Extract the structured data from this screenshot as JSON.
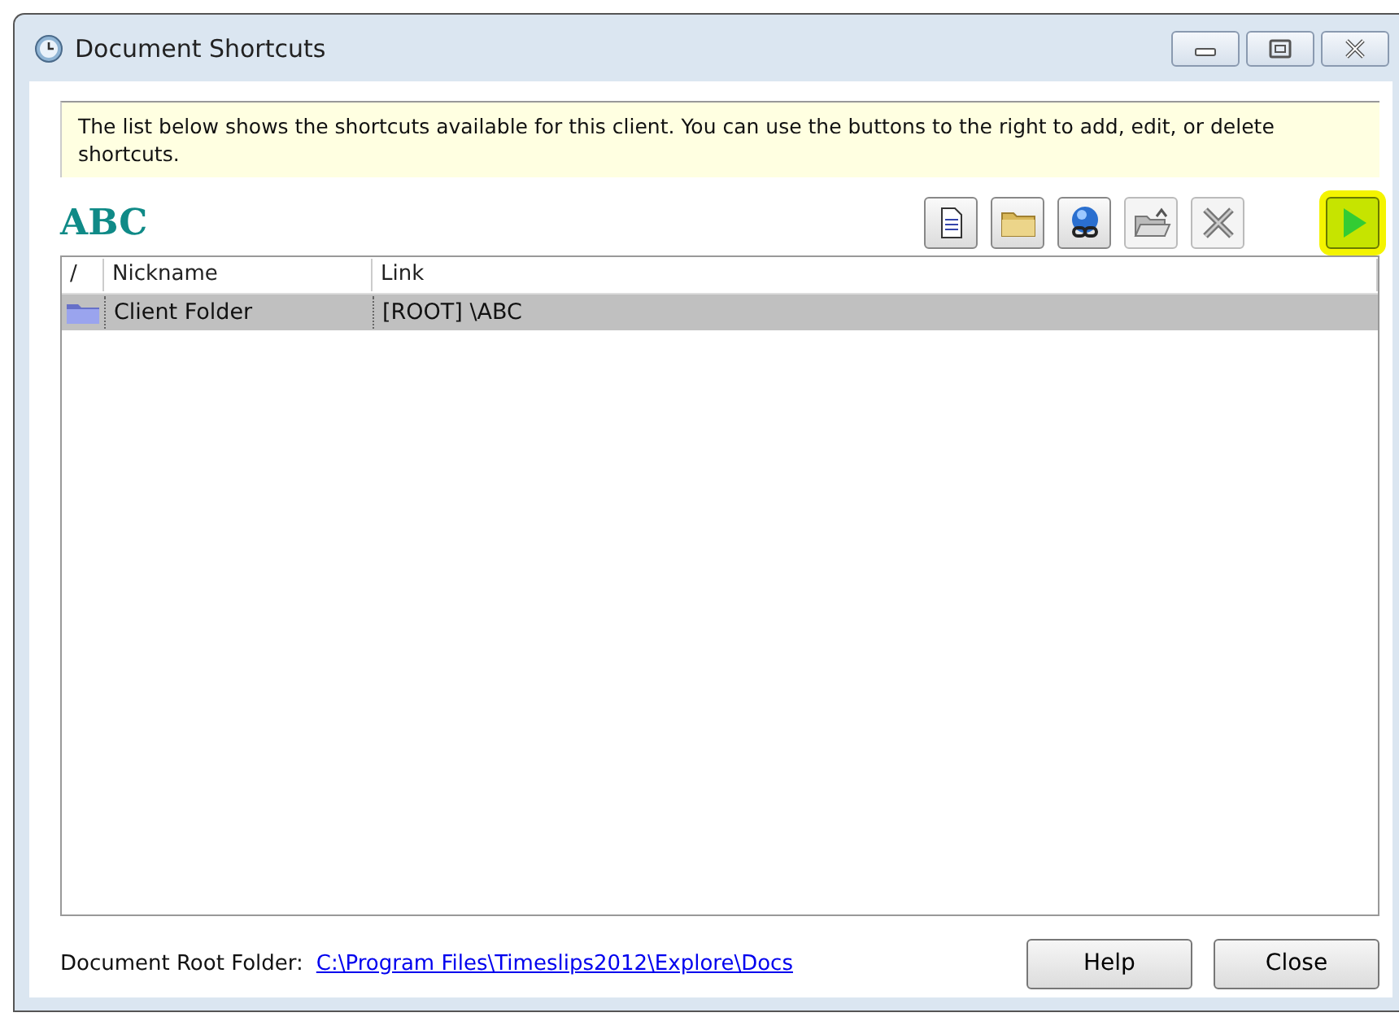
{
  "window": {
    "title": "Document Shortcuts",
    "controls": [
      {
        "kind": "minimize"
      },
      {
        "kind": "maximize"
      },
      {
        "kind": "close"
      }
    ]
  },
  "info": "The list below shows the shortcuts available for this client. You can use the buttons to the right to add, edit, or delete shortcuts.",
  "client": "ABC",
  "toolbar": [
    {
      "kind": "document",
      "disabled": false,
      "highlighted": false
    },
    {
      "kind": "folder",
      "disabled": false,
      "highlighted": false
    },
    {
      "kind": "web-link",
      "disabled": false,
      "highlighted": false
    },
    {
      "kind": "open-folder",
      "disabled": true,
      "highlighted": false
    },
    {
      "kind": "delete",
      "disabled": true,
      "highlighted": false
    },
    {
      "kind": "run",
      "disabled": false,
      "highlighted": true
    }
  ],
  "table": {
    "sort_mark": "/",
    "columns": [
      "Nickname",
      "Link"
    ],
    "rows": [
      {
        "kind": "folder",
        "nickname": "Client Folder",
        "link": "[ROOT] \\ABC",
        "selected": true
      }
    ]
  },
  "footer": {
    "label": "Document Root Folder:",
    "link": "C:\\Program Files\\Timeslips2012\\Explore\\Docs",
    "buttons": [
      "Help",
      "Close"
    ]
  }
}
